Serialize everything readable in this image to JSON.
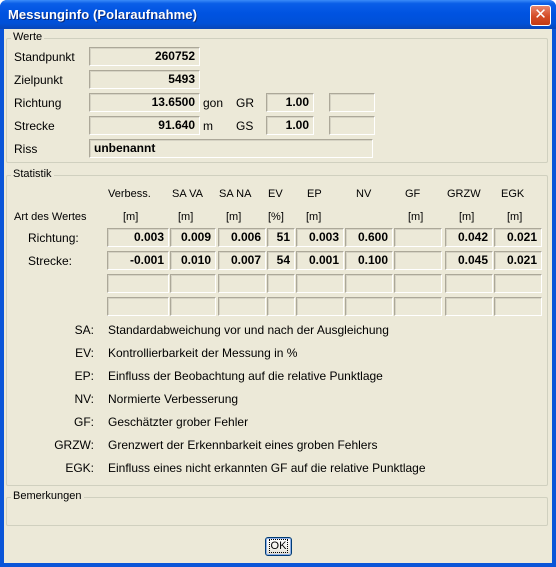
{
  "window": {
    "title": "Messunginfo (Polaraufnahme)",
    "close_symbol": "✕"
  },
  "werte": {
    "group_label": "Werte",
    "standpunkt": {
      "label": "Standpunkt",
      "value": "260752"
    },
    "zielpunkt": {
      "label": "Zielpunkt",
      "value": "5493"
    },
    "richtung": {
      "label": "Richtung",
      "value": "13.6500",
      "unit": "gon",
      "gr_label": "GR",
      "gr_value": "1.00",
      "extra": ""
    },
    "strecke": {
      "label": "Strecke",
      "value": "91.640",
      "unit": "m",
      "gs_label": "GS",
      "gs_value": "1.00",
      "extra": ""
    },
    "riss": {
      "label": "Riss",
      "value": "unbenannt"
    }
  },
  "statistik": {
    "group_label": "Statistik",
    "columns": [
      "Verbess.",
      "SA VA",
      "SA NA",
      "EV",
      "EP",
      "NV",
      "GF",
      "GRZW",
      "EGK"
    ],
    "row_header_label": "Art des Wertes",
    "units": [
      "[m]",
      "[m]",
      "[m]",
      "[%]",
      "[m]",
      "",
      "[m]",
      "[m]",
      "[m]"
    ],
    "rows": [
      {
        "label": "Richtung:",
        "values": [
          "0.003",
          "0.009",
          "0.006",
          "51",
          "0.003",
          "0.600",
          "",
          "0.042",
          "0.021"
        ]
      },
      {
        "label": "Strecke:",
        "values": [
          "-0.001",
          "0.010",
          "0.007",
          "54",
          "0.001",
          "0.100",
          "",
          "0.045",
          "0.021"
        ]
      },
      {
        "label": "",
        "values": [
          "",
          "",
          "",
          "",
          "",
          "",
          "",
          "",
          ""
        ]
      },
      {
        "label": "",
        "values": [
          "",
          "",
          "",
          "",
          "",
          "",
          "",
          "",
          ""
        ]
      }
    ],
    "legend": [
      {
        "key": "SA:",
        "text": "Standardabweichung vor und nach der Ausgleichung"
      },
      {
        "key": "EV:",
        "text": "Kontrollierbarkeit der Messung in %"
      },
      {
        "key": "EP:",
        "text": "Einfluss der Beobachtung auf die relative Punktlage"
      },
      {
        "key": "NV:",
        "text": "Normierte Verbesserung"
      },
      {
        "key": "GF:",
        "text": "Geschätzter grober Fehler"
      },
      {
        "key": "GRZW:",
        "text": "Grenzwert der Erkennbarkeit eines groben Fehlers"
      },
      {
        "key": "EGK:",
        "text": "Einfluss eines nicht erkannten GF auf die relative Punktlage"
      }
    ]
  },
  "bemerkungen": {
    "group_label": "Bemerkungen",
    "text": ""
  },
  "ok_label": "OK"
}
